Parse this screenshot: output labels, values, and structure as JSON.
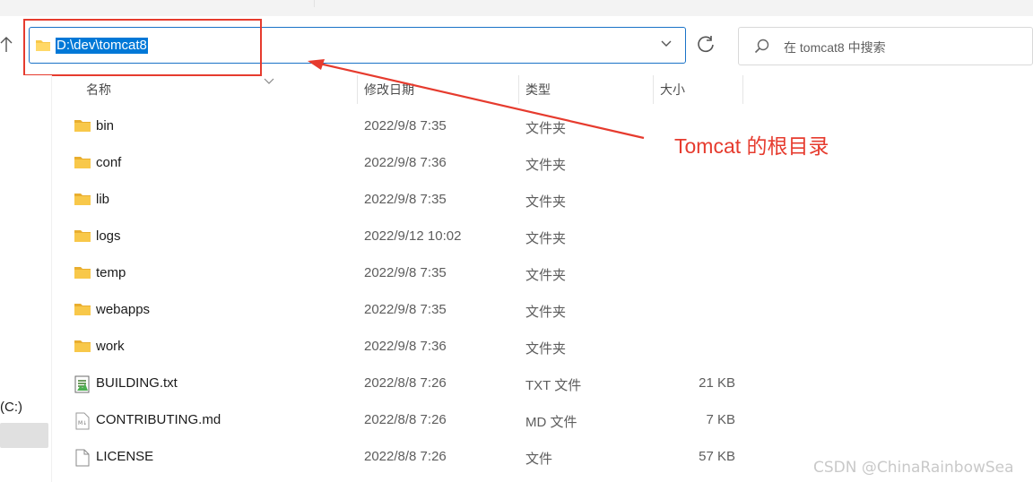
{
  "address_bar": {
    "path": "D:\\dev\\tomcat8"
  },
  "search": {
    "placeholder": "在 tomcat8 中搜索"
  },
  "columns": {
    "name": "名称",
    "modified": "修改日期",
    "type": "类型",
    "size": "大小"
  },
  "nav": {
    "drive_label": "(C:)"
  },
  "files": [
    {
      "name": "bin",
      "modified": "2022/9/8 7:35",
      "type": "文件夹",
      "size": "",
      "icon": "folder-icon"
    },
    {
      "name": "conf",
      "modified": "2022/9/8 7:36",
      "type": "文件夹",
      "size": "",
      "icon": "folder-icon"
    },
    {
      "name": "lib",
      "modified": "2022/9/8 7:35",
      "type": "文件夹",
      "size": "",
      "icon": "folder-icon"
    },
    {
      "name": "logs",
      "modified": "2022/9/12 10:02",
      "type": "文件夹",
      "size": "",
      "icon": "folder-icon"
    },
    {
      "name": "temp",
      "modified": "2022/9/8 7:35",
      "type": "文件夹",
      "size": "",
      "icon": "folder-icon"
    },
    {
      "name": "webapps",
      "modified": "2022/9/8 7:35",
      "type": "文件夹",
      "size": "",
      "icon": "folder-icon"
    },
    {
      "name": "work",
      "modified": "2022/9/8 7:36",
      "type": "文件夹",
      "size": "",
      "icon": "folder-icon"
    },
    {
      "name": "BUILDING.txt",
      "modified": "2022/8/8 7:26",
      "type": "TXT 文件",
      "size": "21 KB",
      "icon": "text-file-icon"
    },
    {
      "name": "CONTRIBUTING.md",
      "modified": "2022/8/8 7:26",
      "type": "MD 文件",
      "size": "7 KB",
      "icon": "markdown-file-icon"
    },
    {
      "name": "LICENSE",
      "modified": "2022/8/8 7:26",
      "type": "文件",
      "size": "57 KB",
      "icon": "file-icon"
    }
  ],
  "annotation": {
    "text": "Tomcat 的根目录",
    "color": "#e63b2e"
  },
  "watermark": "CSDN @ChinaRainbowSea",
  "colors": {
    "accent": "#0078d7",
    "folder": "#f8c84a"
  }
}
